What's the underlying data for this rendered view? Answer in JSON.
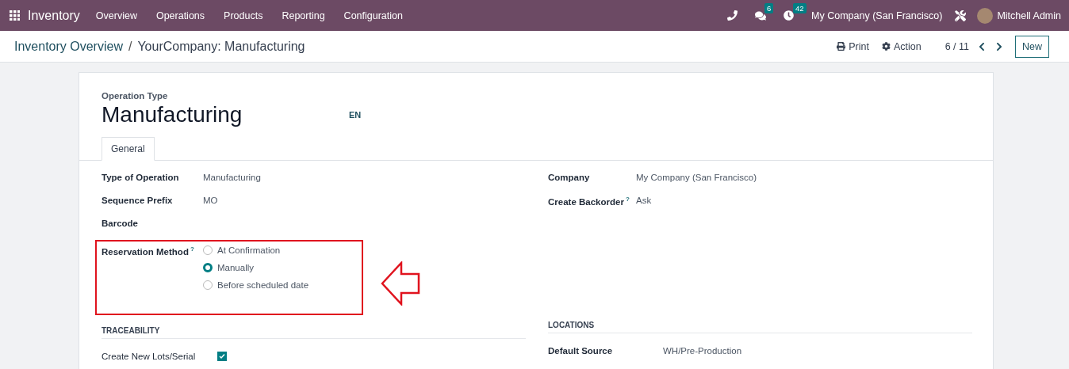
{
  "navbar": {
    "app_name": "Inventory",
    "menu": [
      "Overview",
      "Operations",
      "Products",
      "Reporting",
      "Configuration"
    ],
    "messages_count": "6",
    "activities_count": "42",
    "company": "My Company (San Francisco)",
    "user": "Mitchell Admin"
  },
  "breadcrumb": {
    "items": [
      "Inventory Overview",
      "YourCompany: Manufacturing"
    ],
    "separator": "/",
    "print": "Print",
    "action": "Action",
    "pager": "6 / 11",
    "new": "New"
  },
  "form": {
    "caption": "Operation Type",
    "title": "Manufacturing",
    "lang": "EN",
    "tabs": [
      {
        "label": "General",
        "selected": true
      }
    ],
    "left_fields": [
      {
        "label": "Type of Operation",
        "value": "Manufacturing"
      },
      {
        "label": "Sequence Prefix",
        "value": "MO"
      },
      {
        "label": "Barcode"
      }
    ],
    "reservation": {
      "label": "Reservation Method",
      "help": "?",
      "options": [
        {
          "label": "At Confirmation",
          "selected": false
        },
        {
          "label": "Manually",
          "selected": true
        },
        {
          "label": "Before scheduled date",
          "selected": false
        }
      ]
    },
    "right_fields": [
      {
        "label": "Company",
        "value": "My Company (San Francisco)"
      },
      {
        "label": "Create Backorder",
        "help": "?",
        "value": "Ask"
      }
    ],
    "traceability": {
      "title": "TRACEABILITY",
      "fields": [
        {
          "label": "Create New Lots/Serial",
          "checked": true
        }
      ]
    },
    "locations": {
      "title": "LOCATIONS",
      "fields": [
        {
          "label": "Default Source",
          "value": "WH/Pre-Production"
        }
      ]
    }
  }
}
